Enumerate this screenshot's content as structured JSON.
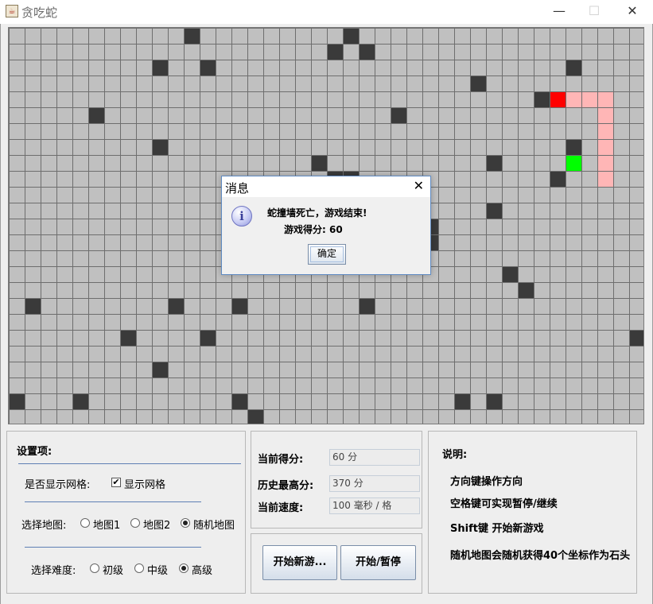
{
  "window": {
    "title": "贪吃蛇",
    "icon": "java-cup-icon",
    "controls": [
      "minimize-icon",
      "maximize-icon",
      "close-icon"
    ]
  },
  "board": {
    "cols": 40,
    "rows": 25,
    "grid_visible": true,
    "colors": {
      "background": "#c0c0c0",
      "grid": "#6e6e6e",
      "stone": "#3a3a3a",
      "snake_head": "#ff0000",
      "snake_body": "#ffb6b6",
      "food": "#00ff00"
    },
    "stones": [
      [
        11,
        0
      ],
      [
        21,
        0
      ],
      [
        20,
        1
      ],
      [
        22,
        1
      ],
      [
        9,
        2
      ],
      [
        12,
        2
      ],
      [
        35,
        2
      ],
      [
        29,
        3
      ],
      [
        33,
        4
      ],
      [
        5,
        5
      ],
      [
        24,
        5
      ],
      [
        9,
        7
      ],
      [
        35,
        7
      ],
      [
        19,
        8
      ],
      [
        30,
        8
      ],
      [
        34,
        9
      ],
      [
        30,
        11
      ],
      [
        26,
        12
      ],
      [
        26,
        13
      ],
      [
        31,
        15
      ],
      [
        32,
        16
      ],
      [
        1,
        17
      ],
      [
        10,
        17
      ],
      [
        14,
        17
      ],
      [
        22,
        17
      ],
      [
        7,
        19
      ],
      [
        12,
        19
      ],
      [
        39,
        19
      ],
      [
        9,
        21
      ],
      [
        0,
        23
      ],
      [
        4,
        23
      ],
      [
        14,
        23
      ],
      [
        28,
        23
      ],
      [
        30,
        23
      ],
      [
        15,
        24
      ],
      [
        21,
        9
      ],
      [
        20,
        9
      ]
    ],
    "snake": [
      [
        34,
        4
      ],
      [
        35,
        4
      ],
      [
        36,
        4
      ],
      [
        37,
        4
      ],
      [
        37,
        5
      ],
      [
        37,
        6
      ],
      [
        37,
        7
      ],
      [
        37,
        8
      ],
      [
        37,
        9
      ]
    ],
    "food": [
      35,
      8
    ]
  },
  "settings": {
    "title": "设置项:",
    "grid_label": "是否显示网格:",
    "grid_checkbox": "显示网格",
    "grid_checked": true,
    "map_label": "选择地图:",
    "map_options": [
      "地图1",
      "地图2",
      "随机地图"
    ],
    "map_selected": 2,
    "difficulty_label": "选择难度:",
    "difficulty_options": [
      "初级",
      "中级",
      "高级"
    ],
    "difficulty_selected": 2
  },
  "stats": {
    "score_label": "当前得分:",
    "score_value": "60 分",
    "best_label": "历史最高分:",
    "best_value": "370 分",
    "speed_label": "当前速度:",
    "speed_value": "100 毫秒 / 格"
  },
  "buttons": {
    "new_game": "开始新游...",
    "pause": "开始/暂停"
  },
  "help": {
    "title": "说明:",
    "lines": [
      "方向键操作方向",
      "空格键可实现暂停/继续",
      "Shift键 开始新游戏",
      "随机地图会随机获得40个坐标作为石头"
    ]
  },
  "dialog": {
    "title": "消息",
    "icon": "info-icon",
    "message": "蛇撞墙死亡，游戏结束!",
    "score_text": "游戏得分: 60",
    "ok_label": "确定"
  }
}
